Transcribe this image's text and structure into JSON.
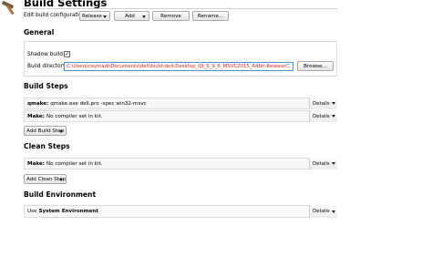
{
  "header": {
    "title": "Build Settings",
    "config_label": "Edit build configuration:",
    "config_value": "Release",
    "add_label": "Add",
    "remove_label": "Remove",
    "rename_label": "Rename..."
  },
  "general": {
    "heading": "General",
    "shadow_label": "Shadow build:",
    "shadow_checked": "✓",
    "dir_label": "Build directory:",
    "dir_value": "C:\\Users\\raymadi\\Documents\\dell\\build-dell-Desktop_Qt_5_9_6_MSVC2015_64bit-Release",
    "browse_label": "Browse..."
  },
  "build_steps": {
    "heading": "Build Steps",
    "steps": [
      {
        "name": "qmake:",
        "text": "qmake.exe dell.pro -spec win32-msvc",
        "details": "Details"
      },
      {
        "name": "Make:",
        "text": "No compiler set in kit.",
        "details": "Details"
      }
    ],
    "add_label": "Add Build Step"
  },
  "clean_steps": {
    "heading": "Clean Steps",
    "steps": [
      {
        "name": "Make:",
        "text": "No compiler set in kit.",
        "details": "Details"
      }
    ],
    "add_label": "Add Clean Step"
  },
  "environment": {
    "heading": "Build Environment",
    "prefix": "Use",
    "value": "System Environment",
    "details": "Details"
  }
}
